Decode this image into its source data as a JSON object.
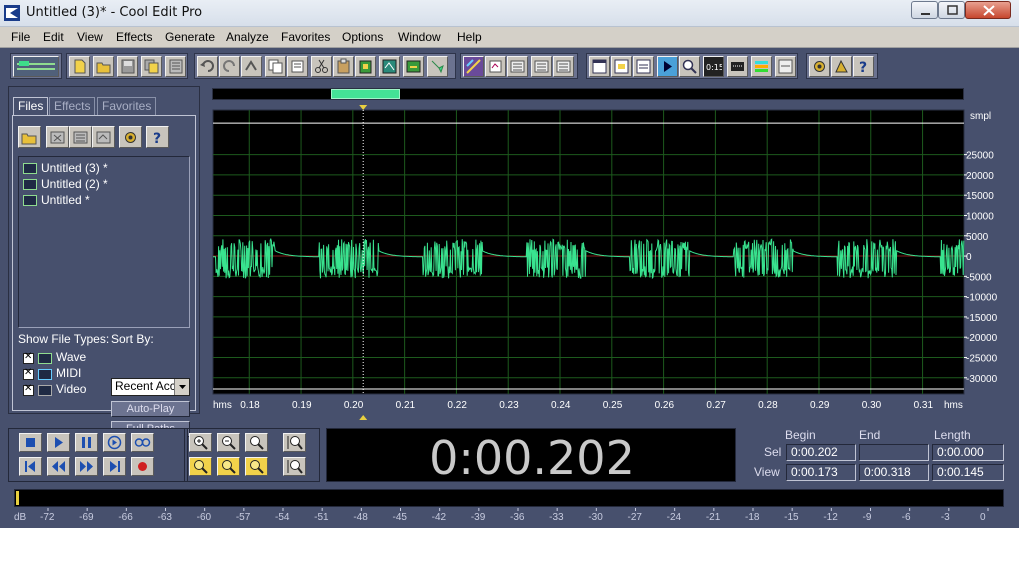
{
  "window": {
    "title": "Untitled (3)* - Cool Edit Pro",
    "minimize_icon": "minimize-icon",
    "maximize_icon": "maximize-icon",
    "close_icon": "close-icon"
  },
  "menu": {
    "items": [
      "File",
      "Edit",
      "View",
      "Effects",
      "Generate",
      "Analyze",
      "Favorites",
      "Options",
      "Window",
      "Help"
    ]
  },
  "toolbar": {
    "buttons": [
      "waveform-multitrack-toggle-icon",
      "new-file-icon",
      "open-file-icon",
      "save-icon",
      "save-all-icon",
      "close-file-icon",
      "undo-icon",
      "redo-icon",
      "repeat-last-icon",
      "copy-icon",
      "cut-icon",
      "paste-icon",
      "paste-new-icon",
      "mix-paste-icon",
      "trim-icon",
      "crop-icon",
      "spectral-view-icon",
      "snap-icon",
      "cue-list-icon",
      "play-list-icon",
      "info-icon",
      "scripts-icon",
      "favorites-icon",
      "time-display-icon",
      "zoom-tool-icon",
      "frequency-analysis-icon",
      "meter-icon",
      "settings-icon",
      "help-icon"
    ]
  },
  "organizer": {
    "tabs": [
      "Files",
      "Effects",
      "Favorites"
    ],
    "active_tab": "Files",
    "files": [
      "Untitled (3) *",
      "Untitled (2) *",
      "Untitled *"
    ],
    "show_file_types_label": "Show File Types:",
    "sort_by_label": "Sort By:",
    "file_types": [
      {
        "label": "Wave",
        "checked": true
      },
      {
        "label": "MIDI",
        "checked": true
      },
      {
        "label": "Video",
        "checked": true
      }
    ],
    "sort_value": "Recent Acc",
    "auto_play_label": "Auto-Play",
    "full_paths_label": "Full Paths"
  },
  "waveform": {
    "y_unit": "smpl",
    "y_ticks": [
      25000,
      20000,
      15000,
      10000,
      5000,
      0,
      -5000,
      -10000,
      -15000,
      -20000,
      -25000,
      -30000
    ],
    "x_unit": "hms",
    "x_ticks": [
      "0.18",
      "0.19",
      "0.20",
      "0.21",
      "0.22",
      "0.23",
      "0.24",
      "0.25",
      "0.26",
      "0.27",
      "0.28",
      "0.29",
      "0.30",
      "0.31"
    ],
    "view_start_sec": 0.173,
    "view_end_sec": 0.318,
    "cursor_sec": 0.202,
    "wave_color": "#39e38f",
    "background_color": "#000000",
    "grid_color": "#1d5a1d",
    "burst_period_sec": 0.02,
    "overview_fraction": [
      0.157,
      0.249
    ]
  },
  "time_display": {
    "value": "0:00.202"
  },
  "selection": {
    "headers": {
      "begin": "Begin",
      "end": "End",
      "length": "Length"
    },
    "rows": [
      {
        "label": "Sel",
        "begin": "0:00.202",
        "end": "",
        "length": "0:00.000"
      },
      {
        "label": "View",
        "begin": "0:00.173",
        "end": "0:00.318",
        "length": "0:00.145"
      }
    ]
  },
  "level_meter": {
    "unit": "dB",
    "ticks": [
      "-72",
      "-69",
      "-66",
      "-63",
      "-60",
      "-57",
      "-54",
      "-51",
      "-48",
      "-45",
      "-42",
      "-39",
      "-36",
      "-33",
      "-30",
      "-27",
      "-24",
      "-21",
      "-18",
      "-15",
      "-12",
      "-9",
      "-6",
      "-3",
      "0"
    ]
  }
}
